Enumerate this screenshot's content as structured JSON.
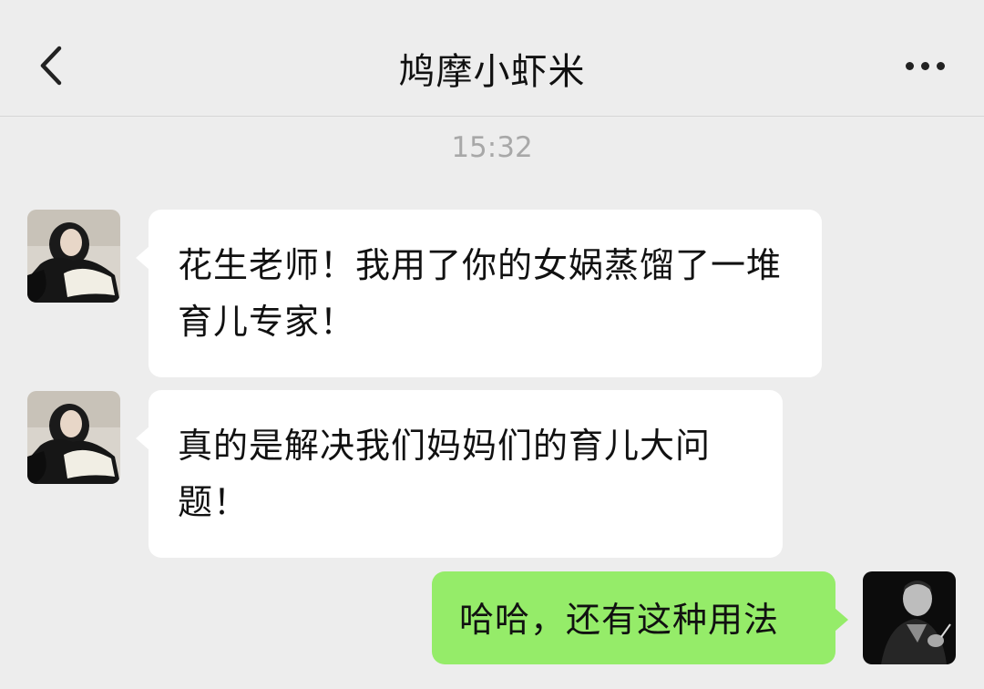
{
  "header": {
    "title": "鸠摩小虾米",
    "back_icon": "chevron-left-icon",
    "more_icon": "more-dots-icon"
  },
  "timestamp": "15:32",
  "messages": [
    {
      "direction": "incoming",
      "text": "花生老师！我用了你的女娲蒸馏了一堆育儿专家！"
    },
    {
      "direction": "incoming",
      "text": "真的是解决我们妈妈们的育儿大问题！"
    },
    {
      "direction": "outgoing",
      "text": "哈哈，还有这种用法"
    }
  ],
  "colors": {
    "background": "#ededed",
    "incoming_bubble": "#ffffff",
    "outgoing_bubble": "#95ec69",
    "timestamp": "#a8a8a8"
  }
}
